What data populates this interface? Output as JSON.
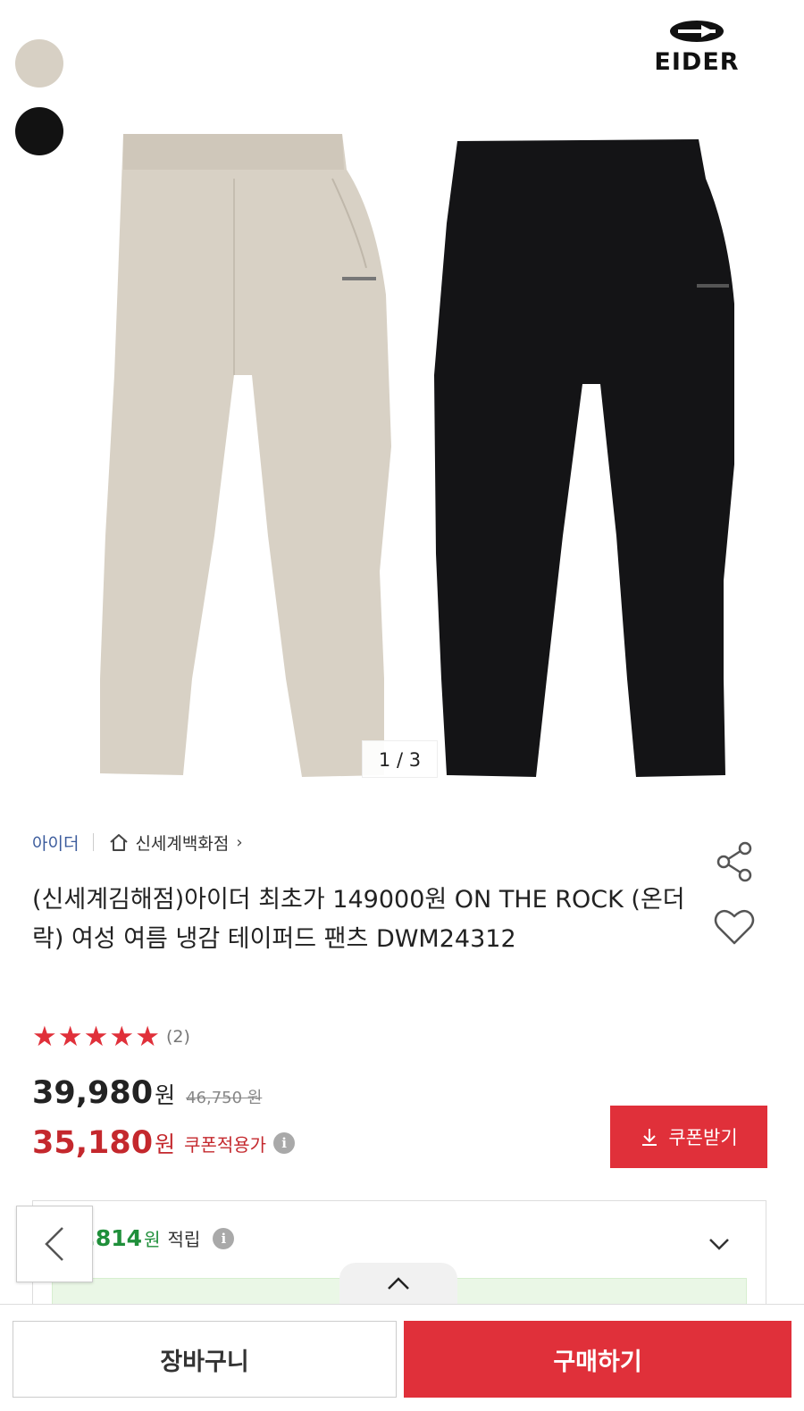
{
  "gallery": {
    "counter": "1 / 3",
    "brand_logo_text": "EIDER",
    "swatch_colors": [
      "#d7d0c4",
      "#121212"
    ]
  },
  "product": {
    "brand": "아이더",
    "store": "신세계백화점",
    "title": "(신세계김해점)아이더 최초가 149000원 ON THE ROCK (온더락) 여성 여름 냉감 테이퍼드 팬츠 DWM24312",
    "rating_stars": 5,
    "review_count": "(2)"
  },
  "pricing": {
    "sale_price": "39,980",
    "sale_unit": "원",
    "original_price": "46,750 원",
    "coupon_price": "35,180",
    "coupon_unit": "원",
    "coupon_label": "쿠폰적용가",
    "coupon_button": "쿠폰받기"
  },
  "points": {
    "value": "2,814",
    "unit": "원",
    "label": "적립"
  },
  "actions": {
    "cart_label": "장바구니",
    "buy_label": "구매하기"
  },
  "colors": {
    "accent_red": "#e0303a",
    "price_red": "#c4282d",
    "points_green": "#1f8f3a",
    "brand_blue": "#3b5b9c"
  }
}
